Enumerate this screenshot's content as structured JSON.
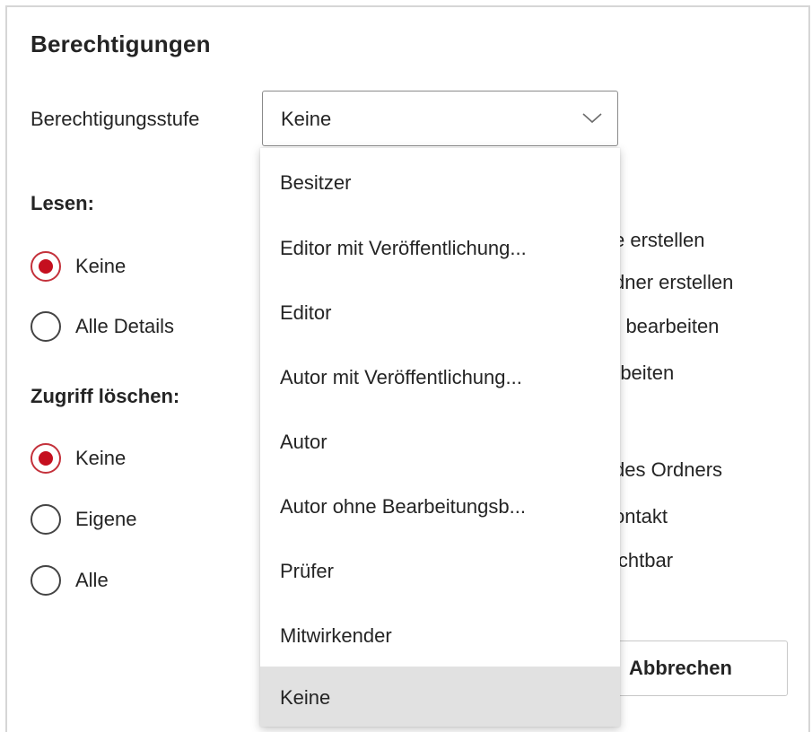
{
  "title": "Berechtigungen",
  "level": {
    "label": "Berechtigungsstufe",
    "selected": "Keine",
    "options": [
      "Besitzer",
      "Editor mit Veröffentlichung...",
      "Editor",
      "Autor mit Veröffentlichung...",
      "Autor",
      "Autor ohne Bearbeitungsb...",
      "Prüfer",
      "Mitwirkender",
      "Keine"
    ]
  },
  "read": {
    "label": "Lesen:",
    "options": [
      "Keine",
      "Alle Details"
    ],
    "selected": "Keine"
  },
  "delete": {
    "label": "Zugriff löschen:",
    "options": [
      "Keine",
      "Eigene",
      "Alle"
    ],
    "selected": "Keine"
  },
  "partial_right": [
    "e erstellen",
    "dner erstellen",
    ") bearbeiten",
    "rbeiten",
    "des Ordners",
    "ontakt",
    "ichtbar"
  ],
  "cancel_label": "Abbrechen",
  "colors": {
    "accent": "#c50f1f",
    "selected_bg": "#e1e1e1",
    "border": "#8a8a8a"
  },
  "icons": {
    "dropdown": "chevron-down-icon"
  }
}
